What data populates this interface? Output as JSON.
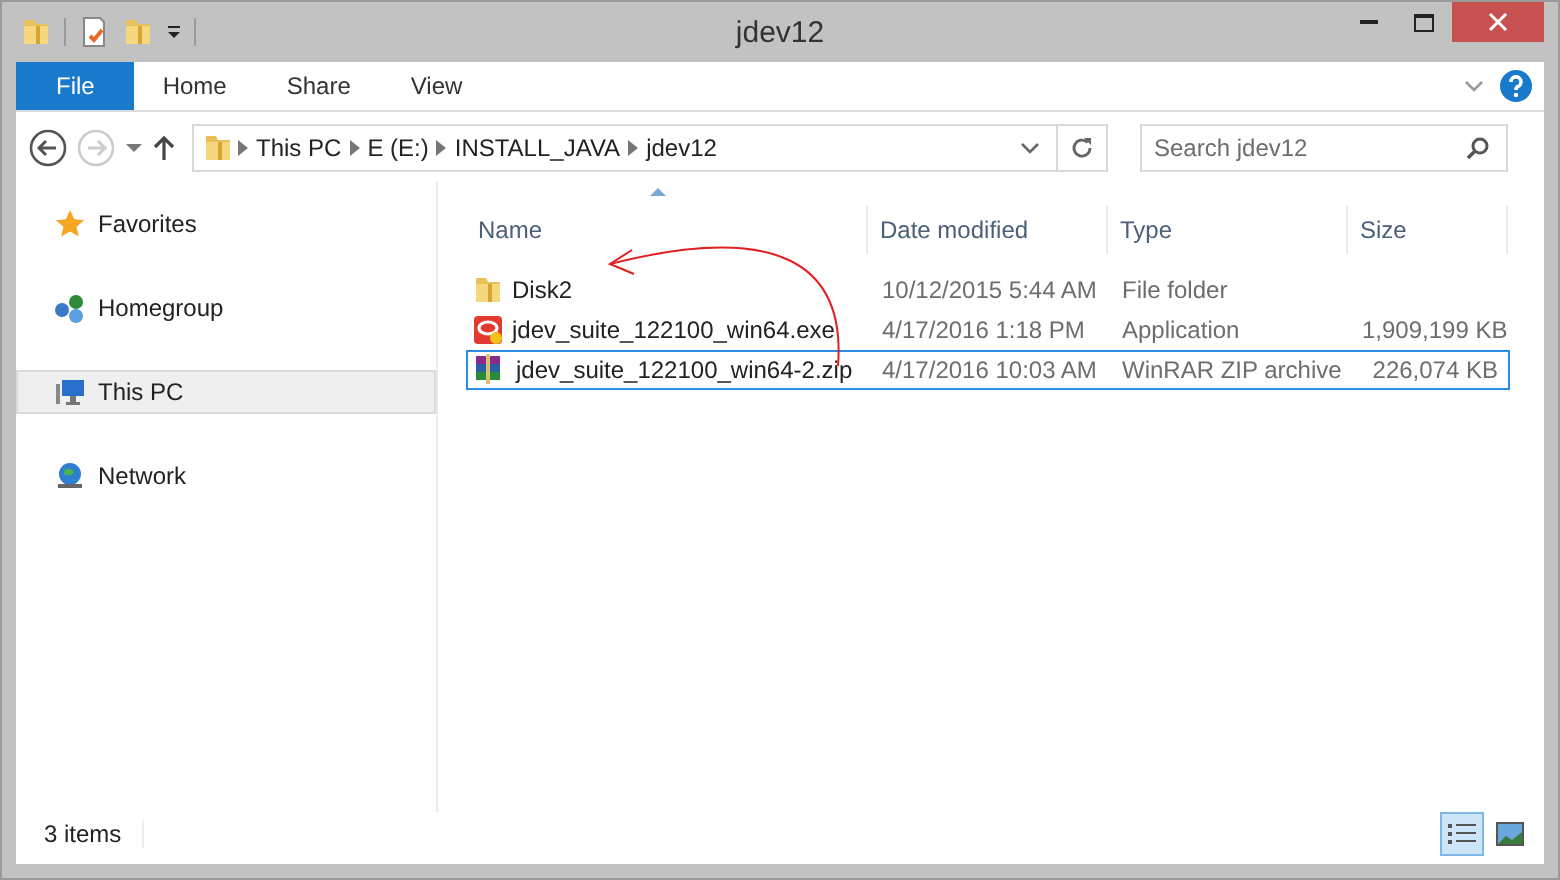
{
  "window": {
    "title": "jdev12"
  },
  "ribbon_tabs": [
    {
      "label": "File",
      "kind": "file"
    },
    {
      "label": "Home",
      "kind": "tab"
    },
    {
      "label": "Share",
      "kind": "tab"
    },
    {
      "label": "View",
      "kind": "tab"
    }
  ],
  "breadcrumbs": [
    "This PC",
    "E (E:)",
    "INSTALL_JAVA",
    "jdev12"
  ],
  "search": {
    "placeholder": "Search jdev12"
  },
  "sidebar": {
    "items": [
      {
        "label": "Favorites",
        "kind": "favorites",
        "selected": false
      },
      {
        "label": "Homegroup",
        "kind": "homegroup",
        "selected": false
      },
      {
        "label": "This PC",
        "kind": "pc",
        "selected": true
      },
      {
        "label": "Network",
        "kind": "network",
        "selected": false
      }
    ]
  },
  "table": {
    "columns": [
      "Name",
      "Date modified",
      "Type",
      "Size"
    ],
    "rows": [
      {
        "name": "Disk2",
        "date": "10/12/2015 5:44 AM",
        "type": "File folder",
        "kind": "folder",
        "selected": false
      },
      {
        "name": "jdev_suite_122100_win64.exe",
        "date": "4/17/2016 1:18 PM",
        "type": "Application",
        "size": "1,909,199 KB",
        "kind": "exe",
        "selected": false
      },
      {
        "name": "jdev_suite_122100_win64-2.zip",
        "date": "4/17/2016 10:03 AM",
        "type": "WinRAR ZIP archive",
        "size": "226,074 KB",
        "kind": "zip",
        "selected": true
      }
    ]
  },
  "status_bar": {
    "count": "3 items",
    "views": [
      {
        "kind": "details",
        "selected": true
      },
      {
        "kind": "large",
        "selected": false
      }
    ]
  }
}
